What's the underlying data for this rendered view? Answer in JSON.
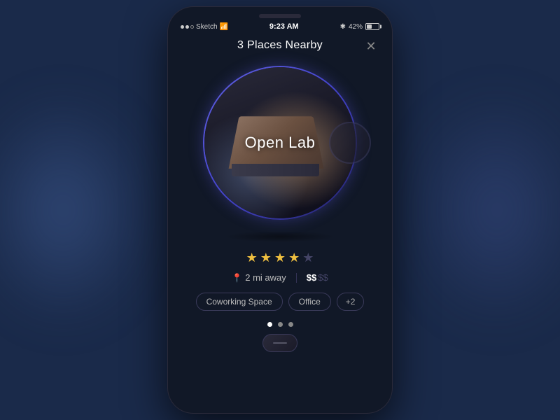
{
  "background": {
    "color": "#1a2a4a"
  },
  "phone": {
    "statusBar": {
      "signal": "●●○",
      "carrier": "Sketch",
      "wifi": "wifi",
      "time": "9:23 AM",
      "bluetooth": "BT",
      "battery": "42%"
    },
    "header": {
      "title": "3 Places Nearby",
      "closeLabel": "✕"
    },
    "card": {
      "placeName": "Open Lab",
      "stars": {
        "filled": 4,
        "empty": 1,
        "total": 5
      },
      "distance": "2 mi away",
      "priceActive": "$$",
      "priceFaded": "$$",
      "tags": [
        "Coworking Space",
        "Office",
        "+2"
      ],
      "pageDots": [
        {
          "active": true
        },
        {
          "active": false
        },
        {
          "active": false
        }
      ]
    }
  }
}
